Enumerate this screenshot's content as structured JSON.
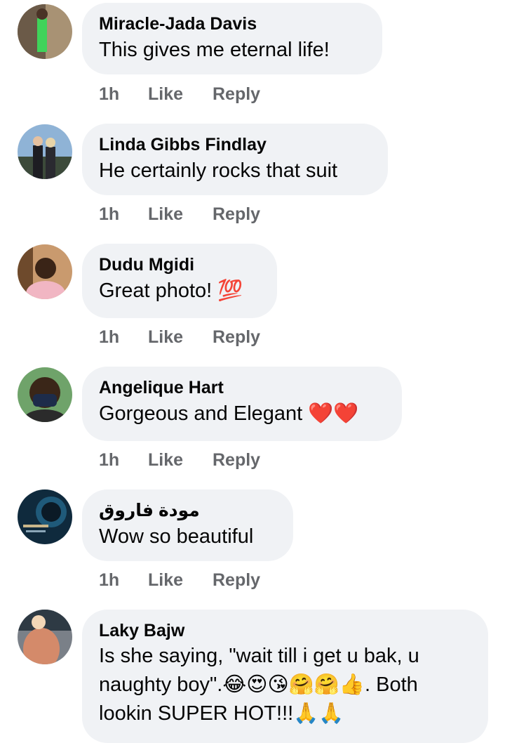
{
  "comments": [
    {
      "name": "Miracle-Jada Davis",
      "text": "This gives me eternal life!",
      "time": "1h",
      "like": "Like",
      "reply": "Reply"
    },
    {
      "name": "Linda Gibbs Findlay",
      "text": "He certainly rocks that suit",
      "time": "1h",
      "like": "Like",
      "reply": "Reply"
    },
    {
      "name": "Dudu Mgidi",
      "text": "Great photo! 💯",
      "time": "1h",
      "like": "Like",
      "reply": "Reply"
    },
    {
      "name": "Angelique Hart",
      "text": "Gorgeous and Elegant ❤️❤️",
      "time": "1h",
      "like": "Like",
      "reply": "Reply"
    },
    {
      "name": "مودة فاروق",
      "text": "Wow so beautiful",
      "time": "1h",
      "like": "Like",
      "reply": "Reply"
    },
    {
      "name": "Laky Bajw",
      "text": "Is she saying, \"wait till i get u bak, u naughty boy\".😂😍😘🤗🤗👍.   Both lookin SUPER HOT!!!🙏🙏"
    }
  ],
  "colors": {
    "bubble": "#f0f2f5",
    "meta": "#65676b",
    "text": "#050505"
  }
}
